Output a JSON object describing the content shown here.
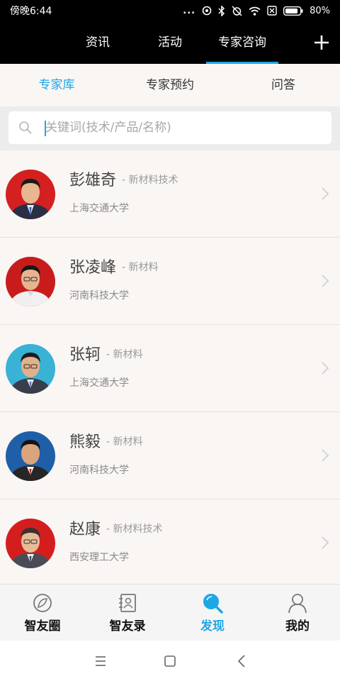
{
  "status_bar": {
    "time": "傍晚6:44",
    "dots": "...",
    "battery_percent": "80%",
    "icons": [
      "tag-icon",
      "bluetooth-icon",
      "alarm-off-icon",
      "wifi-icon",
      "sim-off-icon",
      "battery-icon"
    ]
  },
  "top_nav": {
    "tabs": [
      {
        "label": "资讯"
      },
      {
        "label": "活动"
      },
      {
        "label": "专家咨询"
      }
    ],
    "active_tab": 2,
    "plus_icon": "plus-icon"
  },
  "sub_tabs": {
    "items": [
      {
        "label": "专家库"
      },
      {
        "label": "专家预约"
      },
      {
        "label": "问答"
      }
    ],
    "active": 0
  },
  "search": {
    "placeholder": "关键词(技术/产品/名称)",
    "value": ""
  },
  "experts": [
    {
      "name": "彭雄奇",
      "field": "- 新材料技术",
      "university": "上海交通大学"
    },
    {
      "name": "张凌峰",
      "field": "- 新材料",
      "university": "河南科技大学"
    },
    {
      "name": "张轲",
      "field": "- 新材料",
      "university": "上海交通大学"
    },
    {
      "name": "熊毅",
      "field": "- 新材料",
      "university": "河南科技大学"
    },
    {
      "name": "赵康",
      "field": "- 新材料技术",
      "university": "西安理工大学"
    }
  ],
  "bottom_nav": {
    "items": [
      {
        "label": "智友圈",
        "icon": "circle-leaf-icon"
      },
      {
        "label": "智友录",
        "icon": "contacts-book-icon"
      },
      {
        "label": "发现",
        "icon": "search-discover-icon"
      },
      {
        "label": "我的",
        "icon": "person-icon"
      }
    ],
    "active": 2
  },
  "colors": {
    "accent": "#1ea7e4",
    "header_bg": "#000000",
    "list_bg": "#faf6f4"
  }
}
